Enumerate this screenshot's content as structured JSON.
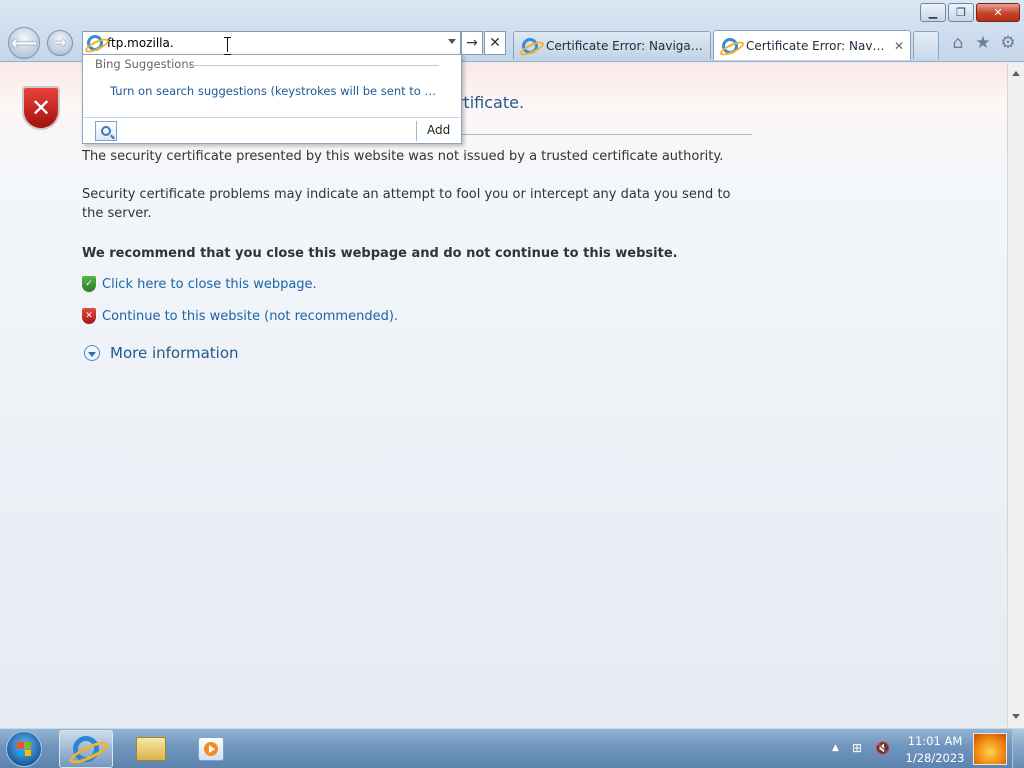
{
  "window": {
    "minimize_glyph": "▁",
    "maximize_glyph": "❐",
    "close_glyph": "✕"
  },
  "nav": {
    "back_glyph": "⟵",
    "forward_glyph": "→"
  },
  "address_bar": {
    "value": "ftp.mozilla.",
    "go_glyph": "→",
    "stop_glyph": "✕"
  },
  "tabs": [
    {
      "label": "Certificate Error: Navigation B...",
      "active": false
    },
    {
      "label": "Certificate Error: Navigatio...",
      "active": true,
      "close_glyph": "✕"
    }
  ],
  "command_icons": [
    "home-icon",
    "favorites-icon",
    "tools-icon"
  ],
  "command_glyphs": {
    "home": "⌂",
    "favorites": "★",
    "tools": "⚙"
  },
  "suggestions": {
    "heading": "Bing Suggestions",
    "item": "Turn on search suggestions (keystrokes will be sent to Bing a...",
    "add_label": "Add"
  },
  "page": {
    "heading_visible": "ertificate.",
    "para1": "The security certificate presented by this website was not issued by a trusted certificate authority.",
    "para2": "Security certificate problems may indicate an attempt to fool you or intercept any data you send to the server.",
    "recommend": "We recommend that you close this webpage and do not continue to this website.",
    "close_link": "Click here to close this webpage.",
    "continue_link": "Continue to this website (not recommended).",
    "more_info": "More information",
    "shield_glyph": "✕",
    "green_glyph": "✓",
    "red_glyph": "✕"
  },
  "taskbar": {
    "time": "11:01 AM",
    "date": "1/28/2023",
    "tray_glyphs": {
      "up": "▲",
      "network": "⊞",
      "volume": "🔇"
    }
  },
  "colors": {
    "link": "#1a64a8",
    "heading": "#1f5a8b",
    "error_red": "#c0211b",
    "safe_green": "#3a9a2f"
  }
}
